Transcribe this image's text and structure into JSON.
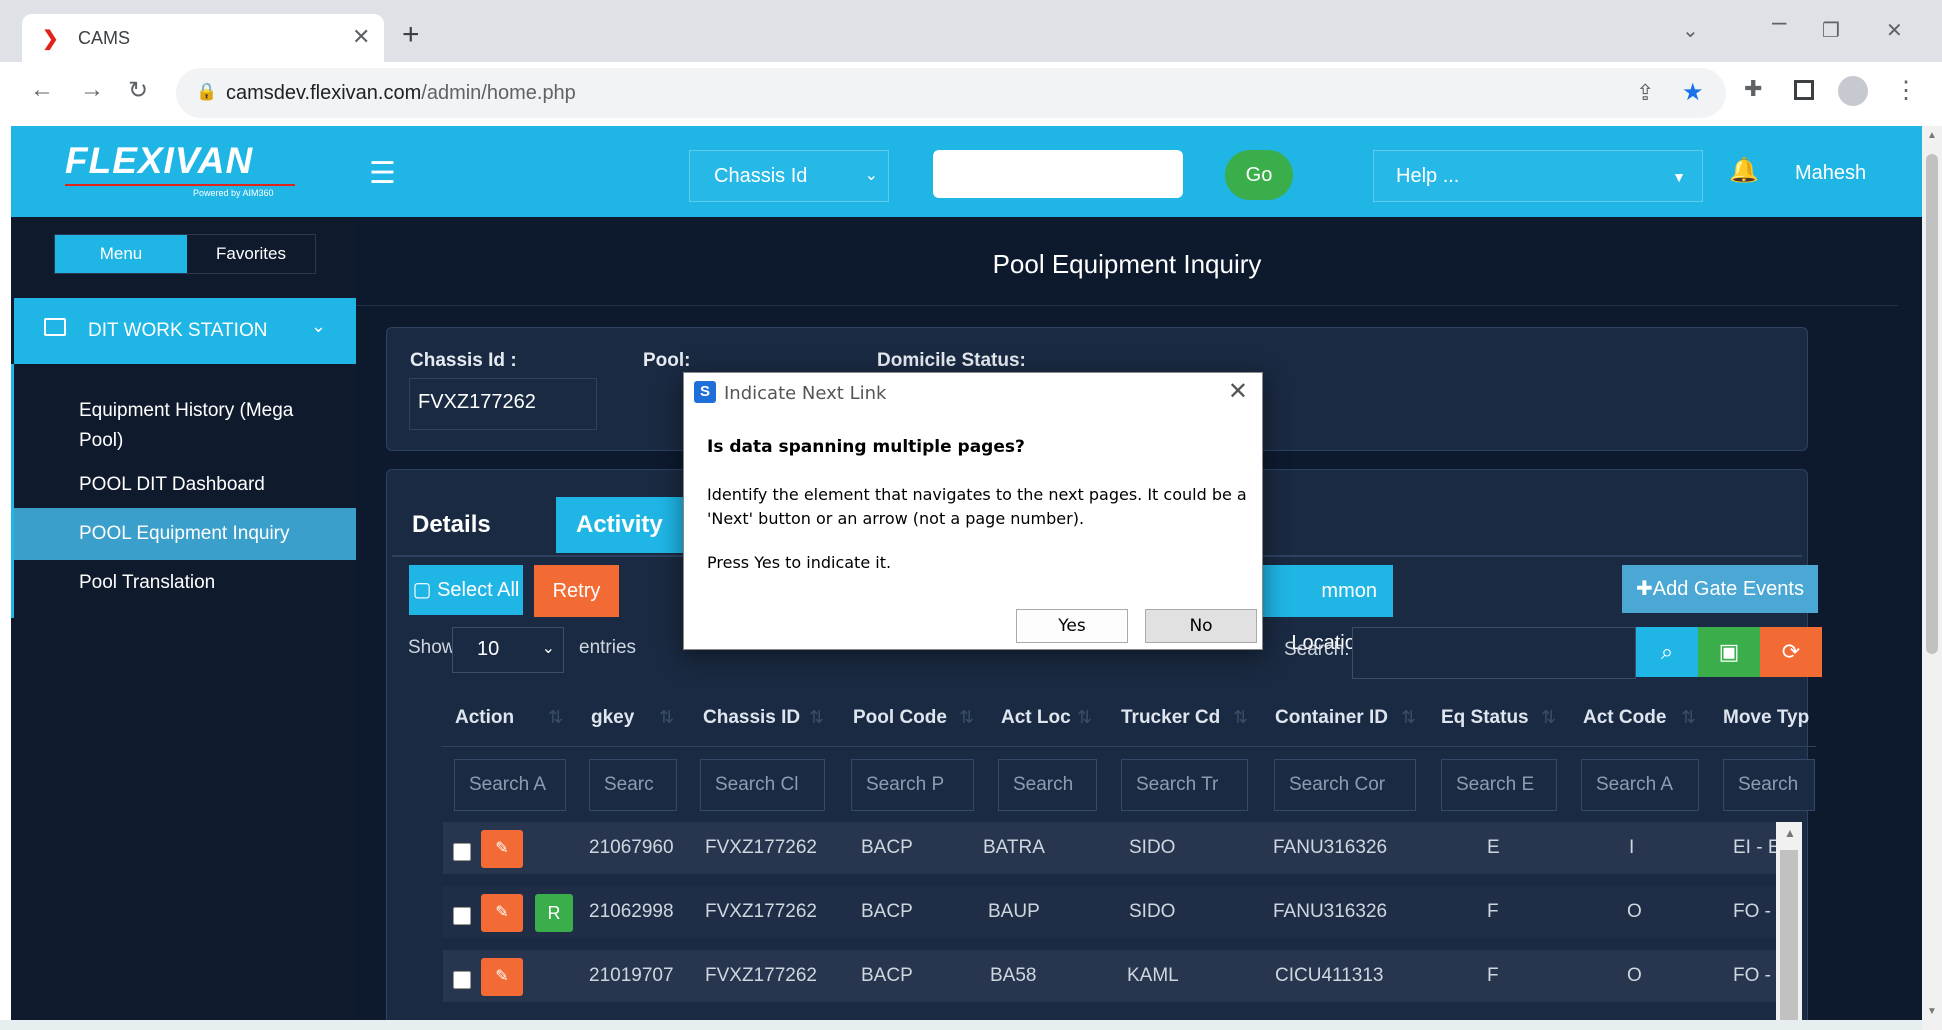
{
  "browser": {
    "tab_title": "CAMS",
    "url_host": "camsdev.flexivan.com",
    "url_path": "/admin/home.php"
  },
  "header": {
    "logo": "FLEXIVAN",
    "logo_sub": "Powered by AIM360",
    "search_type": "Chassis Id",
    "go_label": "Go",
    "help_label": "Help ...",
    "user_name": "Mahesh"
  },
  "sidebar": {
    "menu_tab": "Menu",
    "favorites_tab": "Favorites",
    "workstation": "DIT WORK STATION",
    "items": [
      {
        "label": "Equipment History (Mega"
      },
      {
        "label": "Pool)"
      },
      {
        "label": "POOL DIT Dashboard"
      },
      {
        "label": "POOL Equipment Inquiry"
      },
      {
        "label": "Pool Translation"
      }
    ]
  },
  "main": {
    "page_title": "Pool Equipment Inquiry",
    "chassis_label": "Chassis Id :",
    "chassis_value": "FVXZ177262",
    "pool_label": "Pool:",
    "domicile_label": "Domicile Status:",
    "tabs": [
      "Details",
      "Activity"
    ],
    "buttons": {
      "select_all": "Select All",
      "retry": "Retry",
      "common_locations": "mmon Locations",
      "add_gate_events": "Add Gate Events"
    },
    "show_label": "Show",
    "entries_value": "10",
    "entries_label": "entries",
    "search_label": "Search:"
  },
  "table": {
    "columns": [
      "Action",
      "gkey",
      "Chassis ID",
      "Pool Code",
      "Act Loc",
      "Trucker Cd",
      "Container ID",
      "Eq Status",
      "Act Code",
      "Move Typ"
    ],
    "filters": [
      "Search A",
      "Searc",
      "Search Cl",
      "Search P",
      "Search",
      "Search Tr",
      "Search Cor",
      "Search E",
      "Search A",
      "Search"
    ],
    "rows": [
      {
        "gkey": "21067960",
        "chassis": "FVXZ177262",
        "pool": "BACP",
        "loc": "BATRA",
        "trucker": "SIDO",
        "container": "FANU316326",
        "eq": "E",
        "act": "I",
        "move": "EI - Er",
        "r": ""
      },
      {
        "gkey": "21062998",
        "chassis": "FVXZ177262",
        "pool": "BACP",
        "loc": "BAUP",
        "trucker": "SIDO",
        "container": "FANU316326",
        "eq": "F",
        "act": "O",
        "move": "FO - F",
        "r": "R"
      },
      {
        "gkey": "21019707",
        "chassis": "FVXZ177262",
        "pool": "BACP",
        "loc": "BA58",
        "trucker": "KAML",
        "container": "CICU411313",
        "eq": "F",
        "act": "O",
        "move": "FO - F",
        "r": ""
      }
    ]
  },
  "dialog": {
    "title": "Indicate Next Link",
    "question": "Is data spanning multiple pages?",
    "text1": "Identify the element that navigates to the next pages. It could be a 'Next' button or an arrow (not a page number).",
    "text2": "Press Yes to indicate it.",
    "yes": "Yes",
    "no": "No"
  },
  "colors": {
    "header": "#1fb6e6",
    "background": "#0f1b2d",
    "go": "#3aae4a",
    "retry": "#f26b35"
  }
}
